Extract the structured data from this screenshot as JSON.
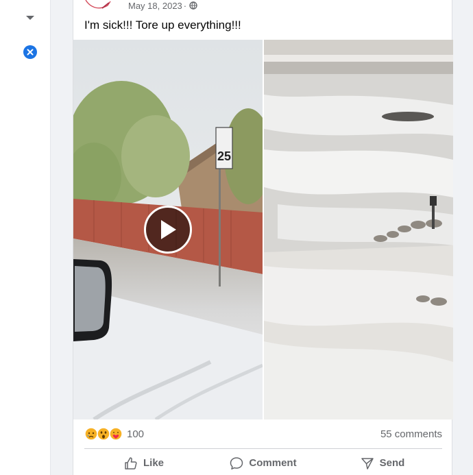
{
  "sidebar": {
    "caret_icon": "caret-down-icon",
    "close_icon": "close-icon",
    "close_color": "#1b74e4"
  },
  "post": {
    "date": "May 18, 2023",
    "separator": "·",
    "privacy_icon": "globe-icon",
    "text": "I'm sick!!! Tore up everything!!!",
    "media": {
      "left_icon": "video-thumbnail",
      "right_icon": "photo-thumbnail",
      "play_icon": "play-icon"
    },
    "reactions": {
      "icons": [
        "sad-emoji-icon",
        "wow-emoji-icon",
        "care-emoji-icon"
      ],
      "count": "100"
    },
    "comments": "55 comments",
    "actions": {
      "like": "Like",
      "comment": "Comment",
      "send": "Send"
    }
  }
}
